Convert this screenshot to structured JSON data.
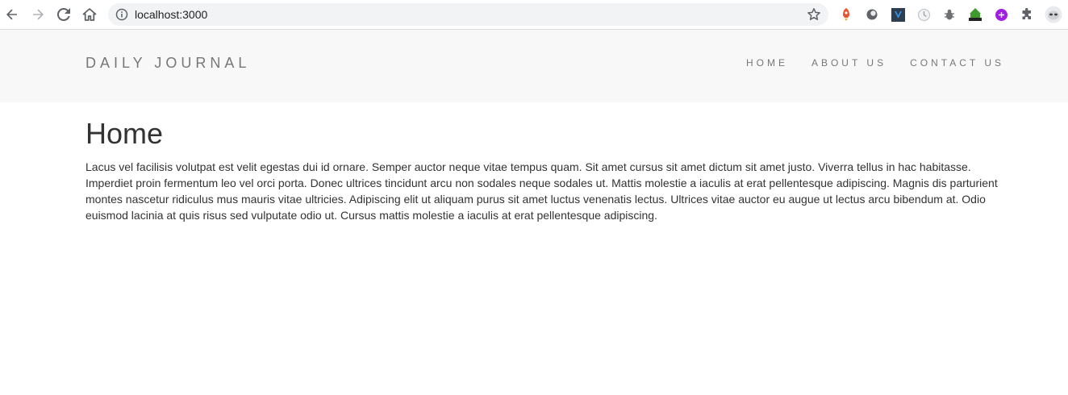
{
  "browser": {
    "url": "localhost:3000",
    "extensions": [
      "rocket-icon",
      "circle-extension-icon",
      "vue-devtools-icon",
      "timer-extension-icon",
      "bug-icon",
      "html-validator-icon",
      "purple-extension-icon",
      "puzzle-icon",
      "profile-avatar-icon"
    ]
  },
  "site": {
    "brand": "DAILY JOURNAL",
    "nav": {
      "home": "HOME",
      "about": "ABOUT US",
      "contact": "CONTACT US"
    }
  },
  "main": {
    "heading": "Home",
    "body": "Lacus vel facilisis volutpat est velit egestas dui id ornare. Semper auctor neque vitae tempus quam. Sit amet cursus sit amet dictum sit amet justo. Viverra tellus in hac habitasse. Imperdiet proin fermentum leo vel orci porta. Donec ultrices tincidunt arcu non sodales neque sodales ut. Mattis molestie a iaculis at erat pellentesque adipiscing. Magnis dis parturient montes nascetur ridiculus mus mauris vitae ultricies. Adipiscing elit ut aliquam purus sit amet luctus venenatis lectus. Ultrices vitae auctor eu augue ut lectus arcu bibendum at. Odio euismod lacinia at quis risus sed vulputate odio ut. Cursus mattis molestie a iaculis at erat pellentesque adipiscing."
  },
  "colors": {
    "navbar_bg": "#f8f8f8",
    "nav_text": "#777777",
    "body_text": "#333333"
  }
}
